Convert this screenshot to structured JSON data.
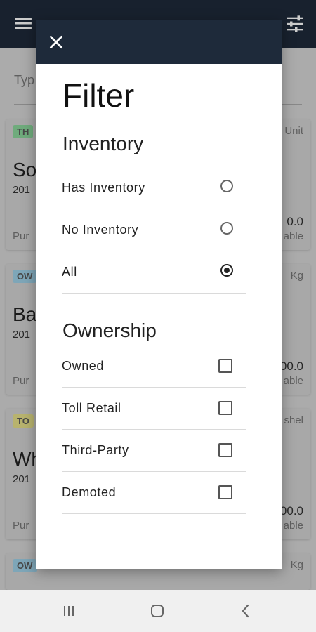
{
  "background": {
    "search_placeholder": "Typ",
    "cards": [
      {
        "badge": "TH",
        "badge_color": "#8bd69c",
        "unit_text": "Unit",
        "name": "So",
        "year": "201",
        "value": "0.0",
        "purpose": "Pur",
        "status": "able"
      },
      {
        "badge": "OW",
        "badge_color": "#9ed0e6",
        "unit_text": "Kg",
        "name": "Ba",
        "year": "201",
        "value": "00.0",
        "purpose": "Pur",
        "status": "able"
      },
      {
        "badge": "TO",
        "badge_color": "#e6e08a",
        "unit_text": "shel",
        "name": "Wh",
        "year": "201",
        "value": "00.0",
        "purpose": "Pur",
        "status": "able"
      },
      {
        "badge": "OW",
        "badge_color": "#9ed0e6",
        "unit_text": "Kg"
      }
    ]
  },
  "dialog": {
    "close_icon": "close-icon",
    "title": "Filter",
    "inventory": {
      "heading": "Inventory",
      "options": [
        {
          "label": "Has Inventory",
          "selected": false
        },
        {
          "label": "No Inventory",
          "selected": false
        },
        {
          "label": "All",
          "selected": true
        }
      ]
    },
    "ownership": {
      "heading": "Ownership",
      "options": [
        {
          "label": "Owned",
          "checked": false
        },
        {
          "label": "Toll Retail",
          "checked": false
        },
        {
          "label": "Third-Party",
          "checked": false
        },
        {
          "label": "Demoted",
          "checked": false
        }
      ]
    }
  },
  "colors": {
    "header": "#1e2a3a",
    "accent": "#222222"
  }
}
